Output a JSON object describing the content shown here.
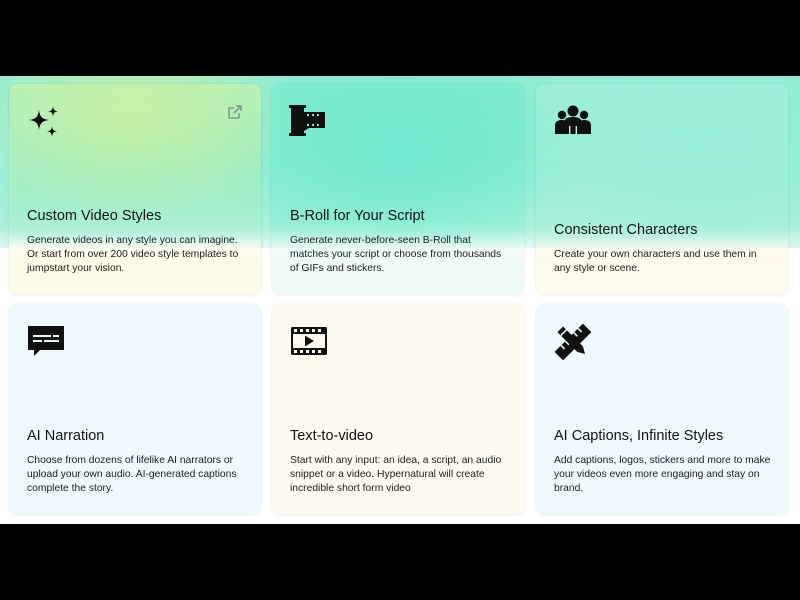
{
  "features": {
    "cards": [
      {
        "icon": "sparkles-icon",
        "title": "Custom Video Styles",
        "description": "Generate videos in any style you can imagine. Or start from over 200 video style templates to jumpstart your vision.",
        "external_link_icon": "external-link-icon"
      },
      {
        "icon": "film-roll-icon",
        "title": "B-Roll for Your Script",
        "description": "Generate never-before-seen B-Roll that matches your script or choose from thousands of GIFs and stickers."
      },
      {
        "icon": "people-group-icon",
        "title": "Consistent Characters",
        "description": "Create your own characters and use them in any style or scene."
      },
      {
        "icon": "speech-bubble-icon",
        "title": "AI Narration",
        "description": "Choose from dozens of lifelike AI narrators or upload your own audio. AI-generated captions complete the story."
      },
      {
        "icon": "video-play-icon",
        "title": "Text-to-video",
        "description": "Start with any input: an idea, a script, an audio snippet or a video. Hypernatural will create incredible short form video"
      },
      {
        "icon": "pencil-ruler-icon",
        "title": "AI Captions, Infinite Styles",
        "description": "Add captions, logos, stickers and more to make your videos even more engaging and stay on brand."
      }
    ]
  },
  "colors": {
    "page_band": "#000000",
    "section_bg": "#ffffff",
    "text": "#141414",
    "glow_green": "#6ee9cf"
  }
}
